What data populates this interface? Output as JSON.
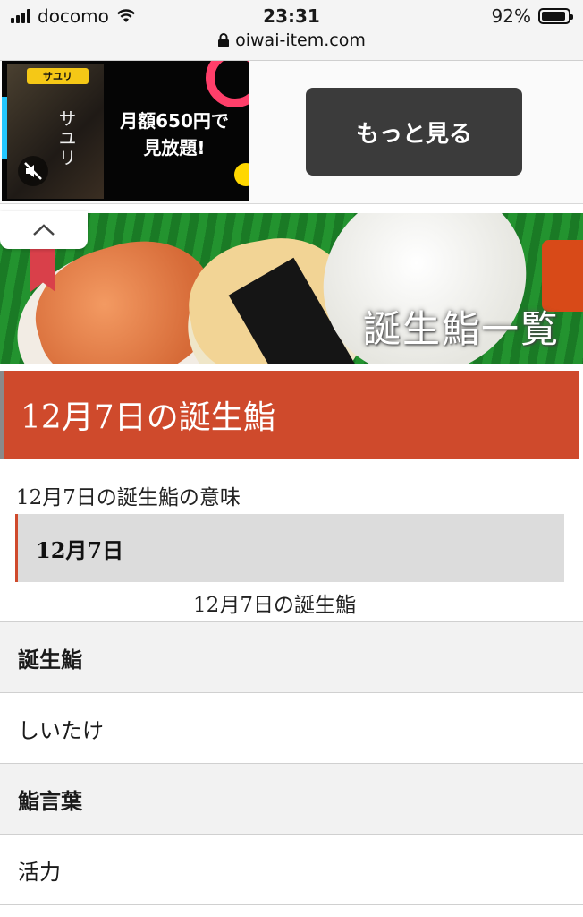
{
  "status_bar": {
    "carrier": "docomo",
    "time": "23:31",
    "battery_percent": "92%",
    "battery_level": 0.92,
    "url": "oiwai-item.com"
  },
  "ad": {
    "tag": "サユリ",
    "vertical_title": "サユリ",
    "promo_line1": "月額650円で",
    "promo_line2": "見放題!",
    "more_button": "もっと見る"
  },
  "hero": {
    "title": "誕生鮨一覧"
  },
  "heading": {
    "title": "12月7日の誕生鮨"
  },
  "article": {
    "meaning_label": "12月7日の誕生鮨の意味",
    "date_box": "12月7日",
    "caption": "12月7日の誕生鮨"
  },
  "table": {
    "rows": [
      {
        "type": "head",
        "text": "誕生鮨"
      },
      {
        "type": "cell",
        "text": "しいたけ"
      },
      {
        "type": "head",
        "text": "鮨言葉"
      },
      {
        "type": "cell",
        "text": "活力"
      }
    ]
  },
  "colors": {
    "accent": "#cf4a2c",
    "ad_button": "#3b3b3b"
  }
}
